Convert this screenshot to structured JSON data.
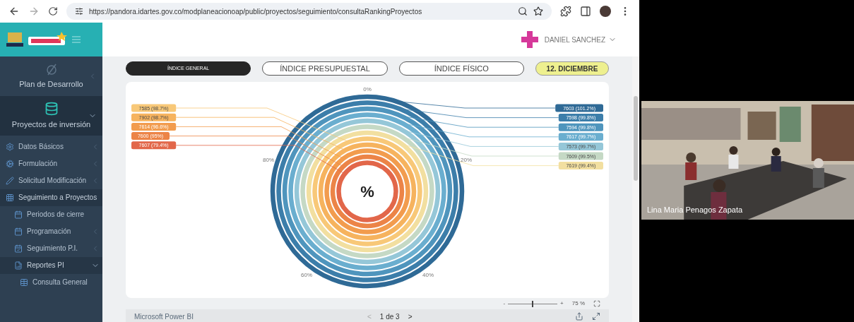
{
  "browser": {
    "url": "https://pandora.idartes.gov.co/modplaneacionoap/public/proyectos/seguimiento/consultaRankingProyectos"
  },
  "header": {
    "user": "DANIEL SANCHEZ"
  },
  "sidebar": {
    "top_items": [
      {
        "label": "Plan de Desarrollo",
        "expanded": false
      },
      {
        "label": "Proyectos de inversión",
        "expanded": true
      }
    ],
    "items": [
      {
        "label": "Datos Básicos",
        "expanded": false
      },
      {
        "label": "Formulación",
        "expanded": false
      },
      {
        "label": "Solicitud Modificación",
        "expanded": false
      },
      {
        "label": "Seguimiento a Proyectos",
        "expanded": true,
        "children": [
          {
            "label": "Periodos de cierre"
          },
          {
            "label": "Programación",
            "expanded": false
          },
          {
            "label": "Seguimiento P.I.",
            "expanded": false
          },
          {
            "label": "Reportes PI",
            "expanded": true,
            "children": [
              {
                "label": "Consulta General"
              }
            ]
          }
        ]
      }
    ]
  },
  "tabs": [
    {
      "label": "ÍNDICE GENERAL",
      "selected": true
    },
    {
      "label": "ÍNDICE PRESUPUESTAL",
      "selected": false
    },
    {
      "label": "ÍNDICE FÍSICO",
      "selected": false
    }
  ],
  "period": "12. DICIEMBRE",
  "chart": {
    "center": "%",
    "ticks": [
      "0%",
      "20%",
      "40%",
      "60%",
      "80%"
    ],
    "rings_right": [
      {
        "label": "7603 (101.2%)",
        "color": "#2f6a96"
      },
      {
        "label": "7598 (99.8%)",
        "color": "#3c7eaa"
      },
      {
        "label": "7594 (99.8%)",
        "color": "#4f95bd"
      },
      {
        "label": "7617 (99.7%)",
        "color": "#6aaecf"
      },
      {
        "label": "7573 (99.7%)",
        "color": "#95c7d8"
      },
      {
        "label": "7609 (99.5%)",
        "color": "#c5d9c5"
      },
      {
        "label": "7619 (99.4%)",
        "color": "#f2dfa0"
      }
    ],
    "rings_left": [
      {
        "label": "7585 (98.7%)",
        "color": "#f8c878"
      },
      {
        "label": "7902 (98.7%)",
        "color": "#f6b35e"
      },
      {
        "label": "7614 (96.6%)",
        "color": "#f29c4e"
      },
      {
        "label": "7600 (95%)",
        "color": "#ec8447"
      },
      {
        "label": "7607 (79.4%)",
        "color": "#e2674a"
      }
    ]
  },
  "zoom": {
    "minus": "-",
    "plus": "+",
    "reading": "75 %",
    "level": 0.5
  },
  "footer": {
    "brand": "Microsoft Power BI",
    "page": "1 de 3",
    "prev": "<",
    "next": ">"
  },
  "video": {
    "kind": "picture",
    "caption": "Lina Maria Penagos Zapata"
  }
}
